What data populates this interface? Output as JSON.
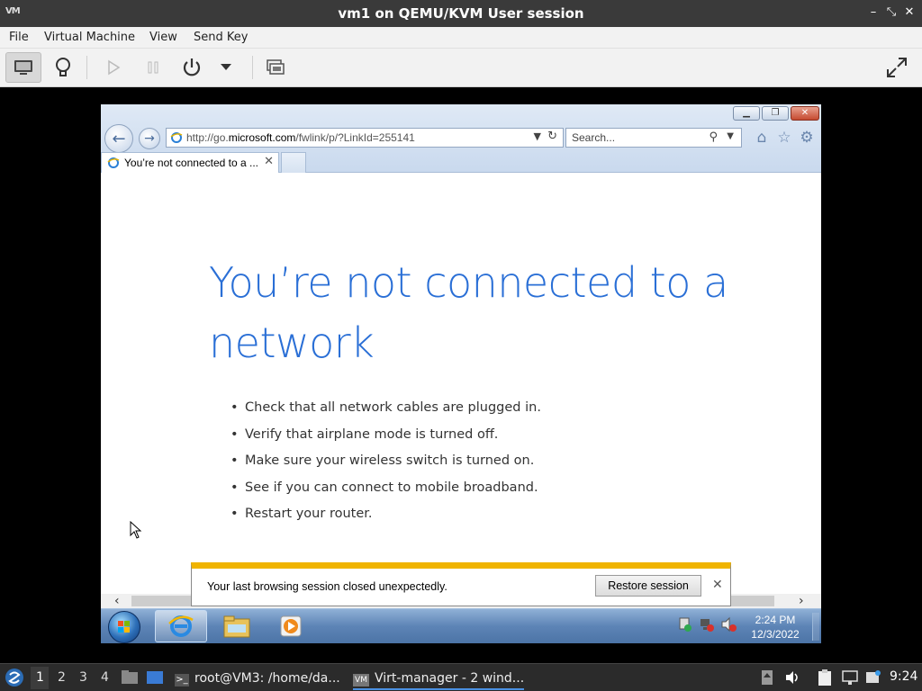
{
  "window": {
    "title": "vm1 on QEMU/KVM User session",
    "logo_text": "VM"
  },
  "menubar": [
    "File",
    "Virtual Machine",
    "View",
    "Send Key"
  ],
  "toolbar": {
    "icons": [
      "monitor-icon",
      "lightbulb-icon",
      "play-icon",
      "pause-icon",
      "power-icon",
      "dropdown-icon",
      "snapshot-icon",
      "fullscreen-icon"
    ]
  },
  "guest": {
    "browser": {
      "url_prefix": "http://go.",
      "url_domain": "microsoft.com",
      "url_path": "/fwlink/p/?LinkId=255141",
      "search_placeholder": "Search...",
      "tab_label": "You’re not connected to a ...",
      "page": {
        "title": "You’re not connected to a network",
        "tips": [
          "Check that all network cables are plugged in.",
          "Verify that airplane mode is turned off.",
          "Make sure your wireless switch is turned on.",
          "See if you can connect to mobile broadband.",
          "Restart your router."
        ]
      },
      "notification": {
        "message": "Your last browsing session closed unexpectedly.",
        "button": "Restore session"
      }
    },
    "taskbar": {
      "time": "2:24 PM",
      "date": "12/3/2022"
    }
  },
  "host_taskbar": {
    "workspaces": [
      "1",
      "2",
      "3",
      "4"
    ],
    "tasks": [
      "root@VM3: /home/da...",
      "Virt-manager - 2 wind..."
    ],
    "clock": "9:24"
  },
  "colors": {
    "accent_blue": "#2a6fd6",
    "notification_bar": "#f0b400",
    "host_bar": "#2b2b2b"
  }
}
